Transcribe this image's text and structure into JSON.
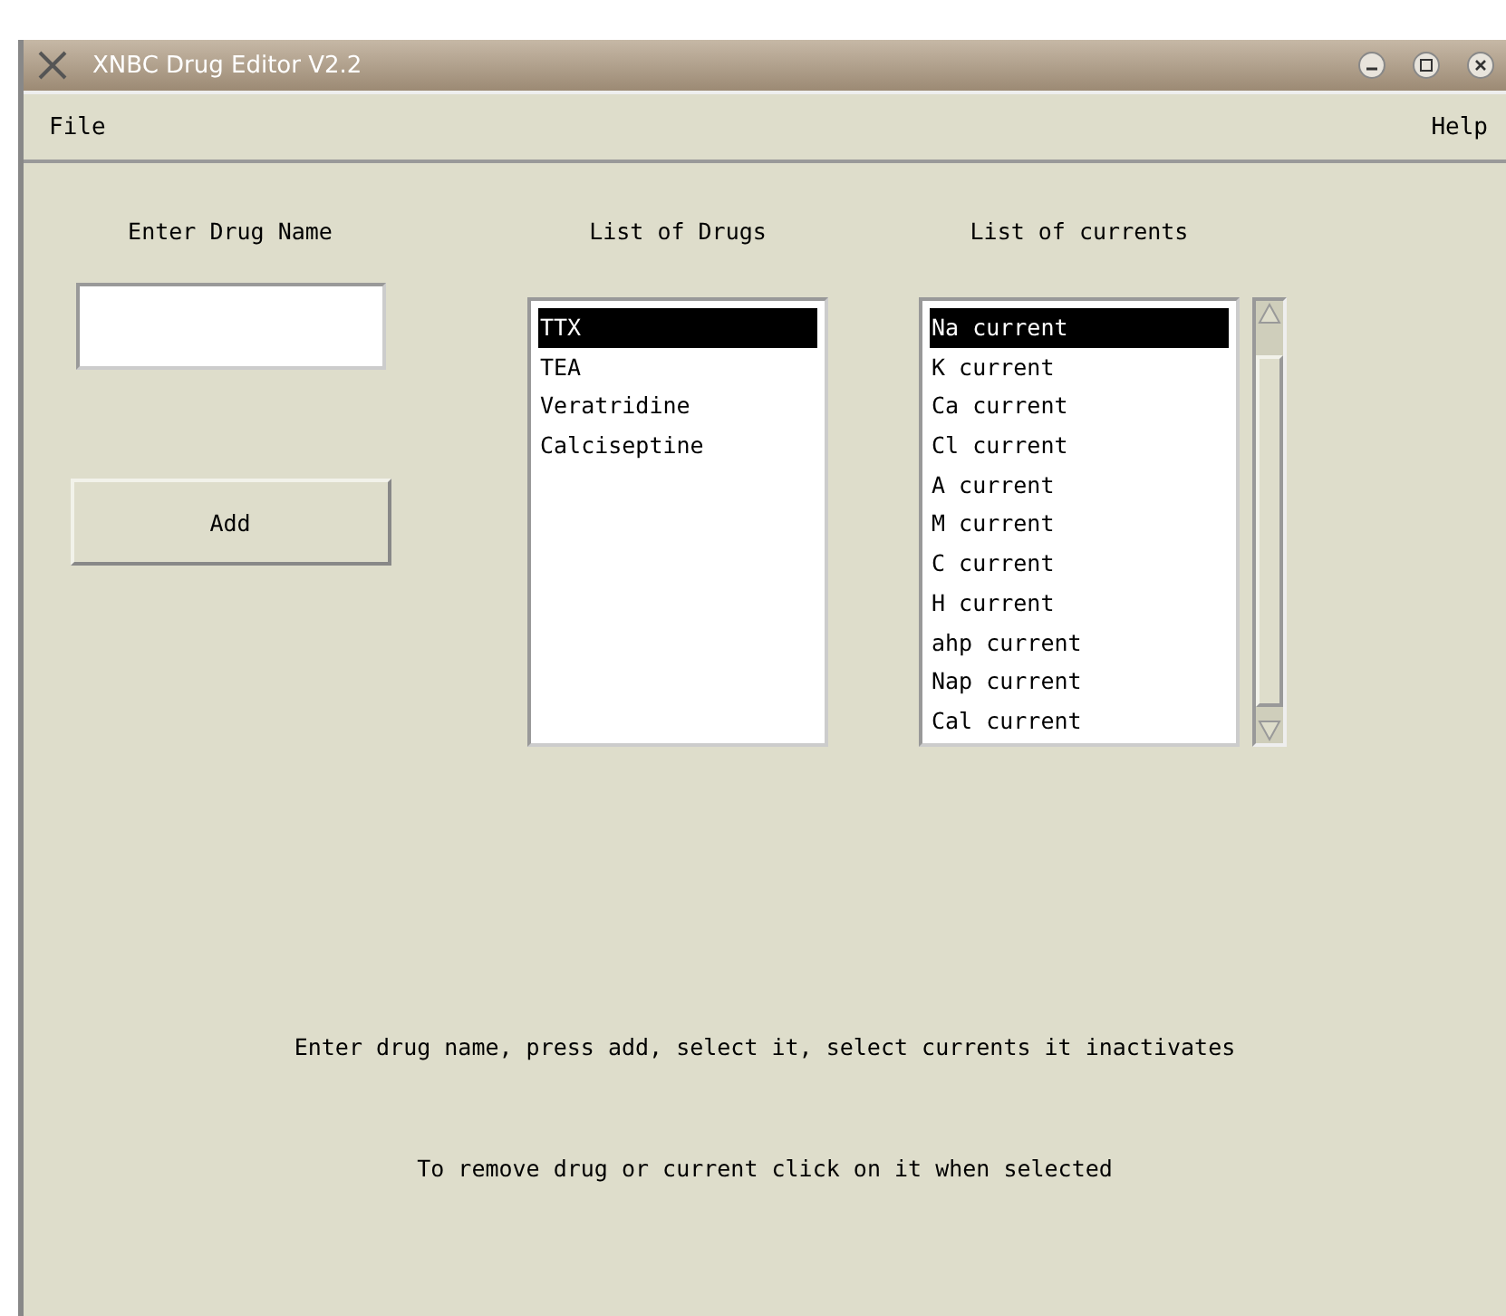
{
  "window": {
    "title": "XNBC Drug Editor V2.2"
  },
  "menu": [
    "File",
    "Help"
  ],
  "drug_name": {
    "label": "Enter Drug Name"
  },
  "add_button": "Add",
  "drugs": {
    "label": "List of Drugs",
    "items": [
      {
        "text": "TTX",
        "selected": true
      },
      {
        "text": "TEA",
        "selected": false
      },
      {
        "text": "Veratridine",
        "selected": false
      },
      {
        "text": "Calciseptine",
        "selected": false
      }
    ]
  },
  "currents": {
    "label": "List of currents",
    "items": [
      {
        "text": "Na current",
        "selected": true
      },
      {
        "text": "K current",
        "selected": false
      },
      {
        "text": "Ca current",
        "selected": false
      },
      {
        "text": "Cl current",
        "selected": false
      },
      {
        "text": "A current",
        "selected": false
      },
      {
        "text": "M current",
        "selected": false
      },
      {
        "text": "C current",
        "selected": false
      },
      {
        "text": "H current",
        "selected": false
      },
      {
        "text": "ahp current",
        "selected": false
      },
      {
        "text": "Nap current",
        "selected": false
      },
      {
        "text": "Cal current",
        "selected": false
      }
    ]
  },
  "instructions": [
    "Enter drug name, press add, select it, select currents it inactivates",
    "To remove drug or current click on it when selected"
  ]
}
